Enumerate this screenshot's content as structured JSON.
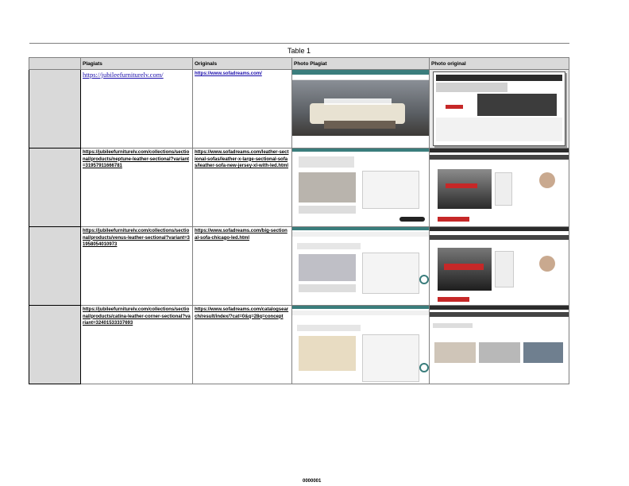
{
  "table": {
    "title": "Table 1",
    "headers": [
      "Plagiats",
      "Originals",
      "Photo Plagiat",
      "Photo original"
    ],
    "rows": [
      {
        "plagiat": "https://jubileefurniturelv.com/",
        "original": "https://www.sofadreams.com/"
      },
      {
        "plagiat": "https://jubileefurniturelv.com/collections/sectional/products/neptune-leather-sectional?variant=31957911666781",
        "original": "https://www.sofadreams.com/leather-sectional-sofas/leather-x-large-sectional-sofas/leather-sofa-new-jersey-xl-with-led.html"
      },
      {
        "plagiat": "https://jubileefurniturelv.com/collections/sectional/products/venus-leather-sectional?variant=31958054010973",
        "original": "https://www.sofadreams.com/big-sectional-sofa-chicago-led.html"
      },
      {
        "plagiat": "https://jubileefurniturelv.com/collections/sectional/products/catina-leather-corner-sectional?variant=32401533337693",
        "original": "https://www.sofadreams.com/catalogsearch/result/index/?cat=0&q=28q=concept"
      }
    ]
  },
  "footer": "0000001",
  "colors": {
    "header_gray": "#d9d9d9",
    "link_blue": "#1a0dab",
    "site_teal": "#3a7d7c",
    "site_dark": "#2b2b2b"
  }
}
